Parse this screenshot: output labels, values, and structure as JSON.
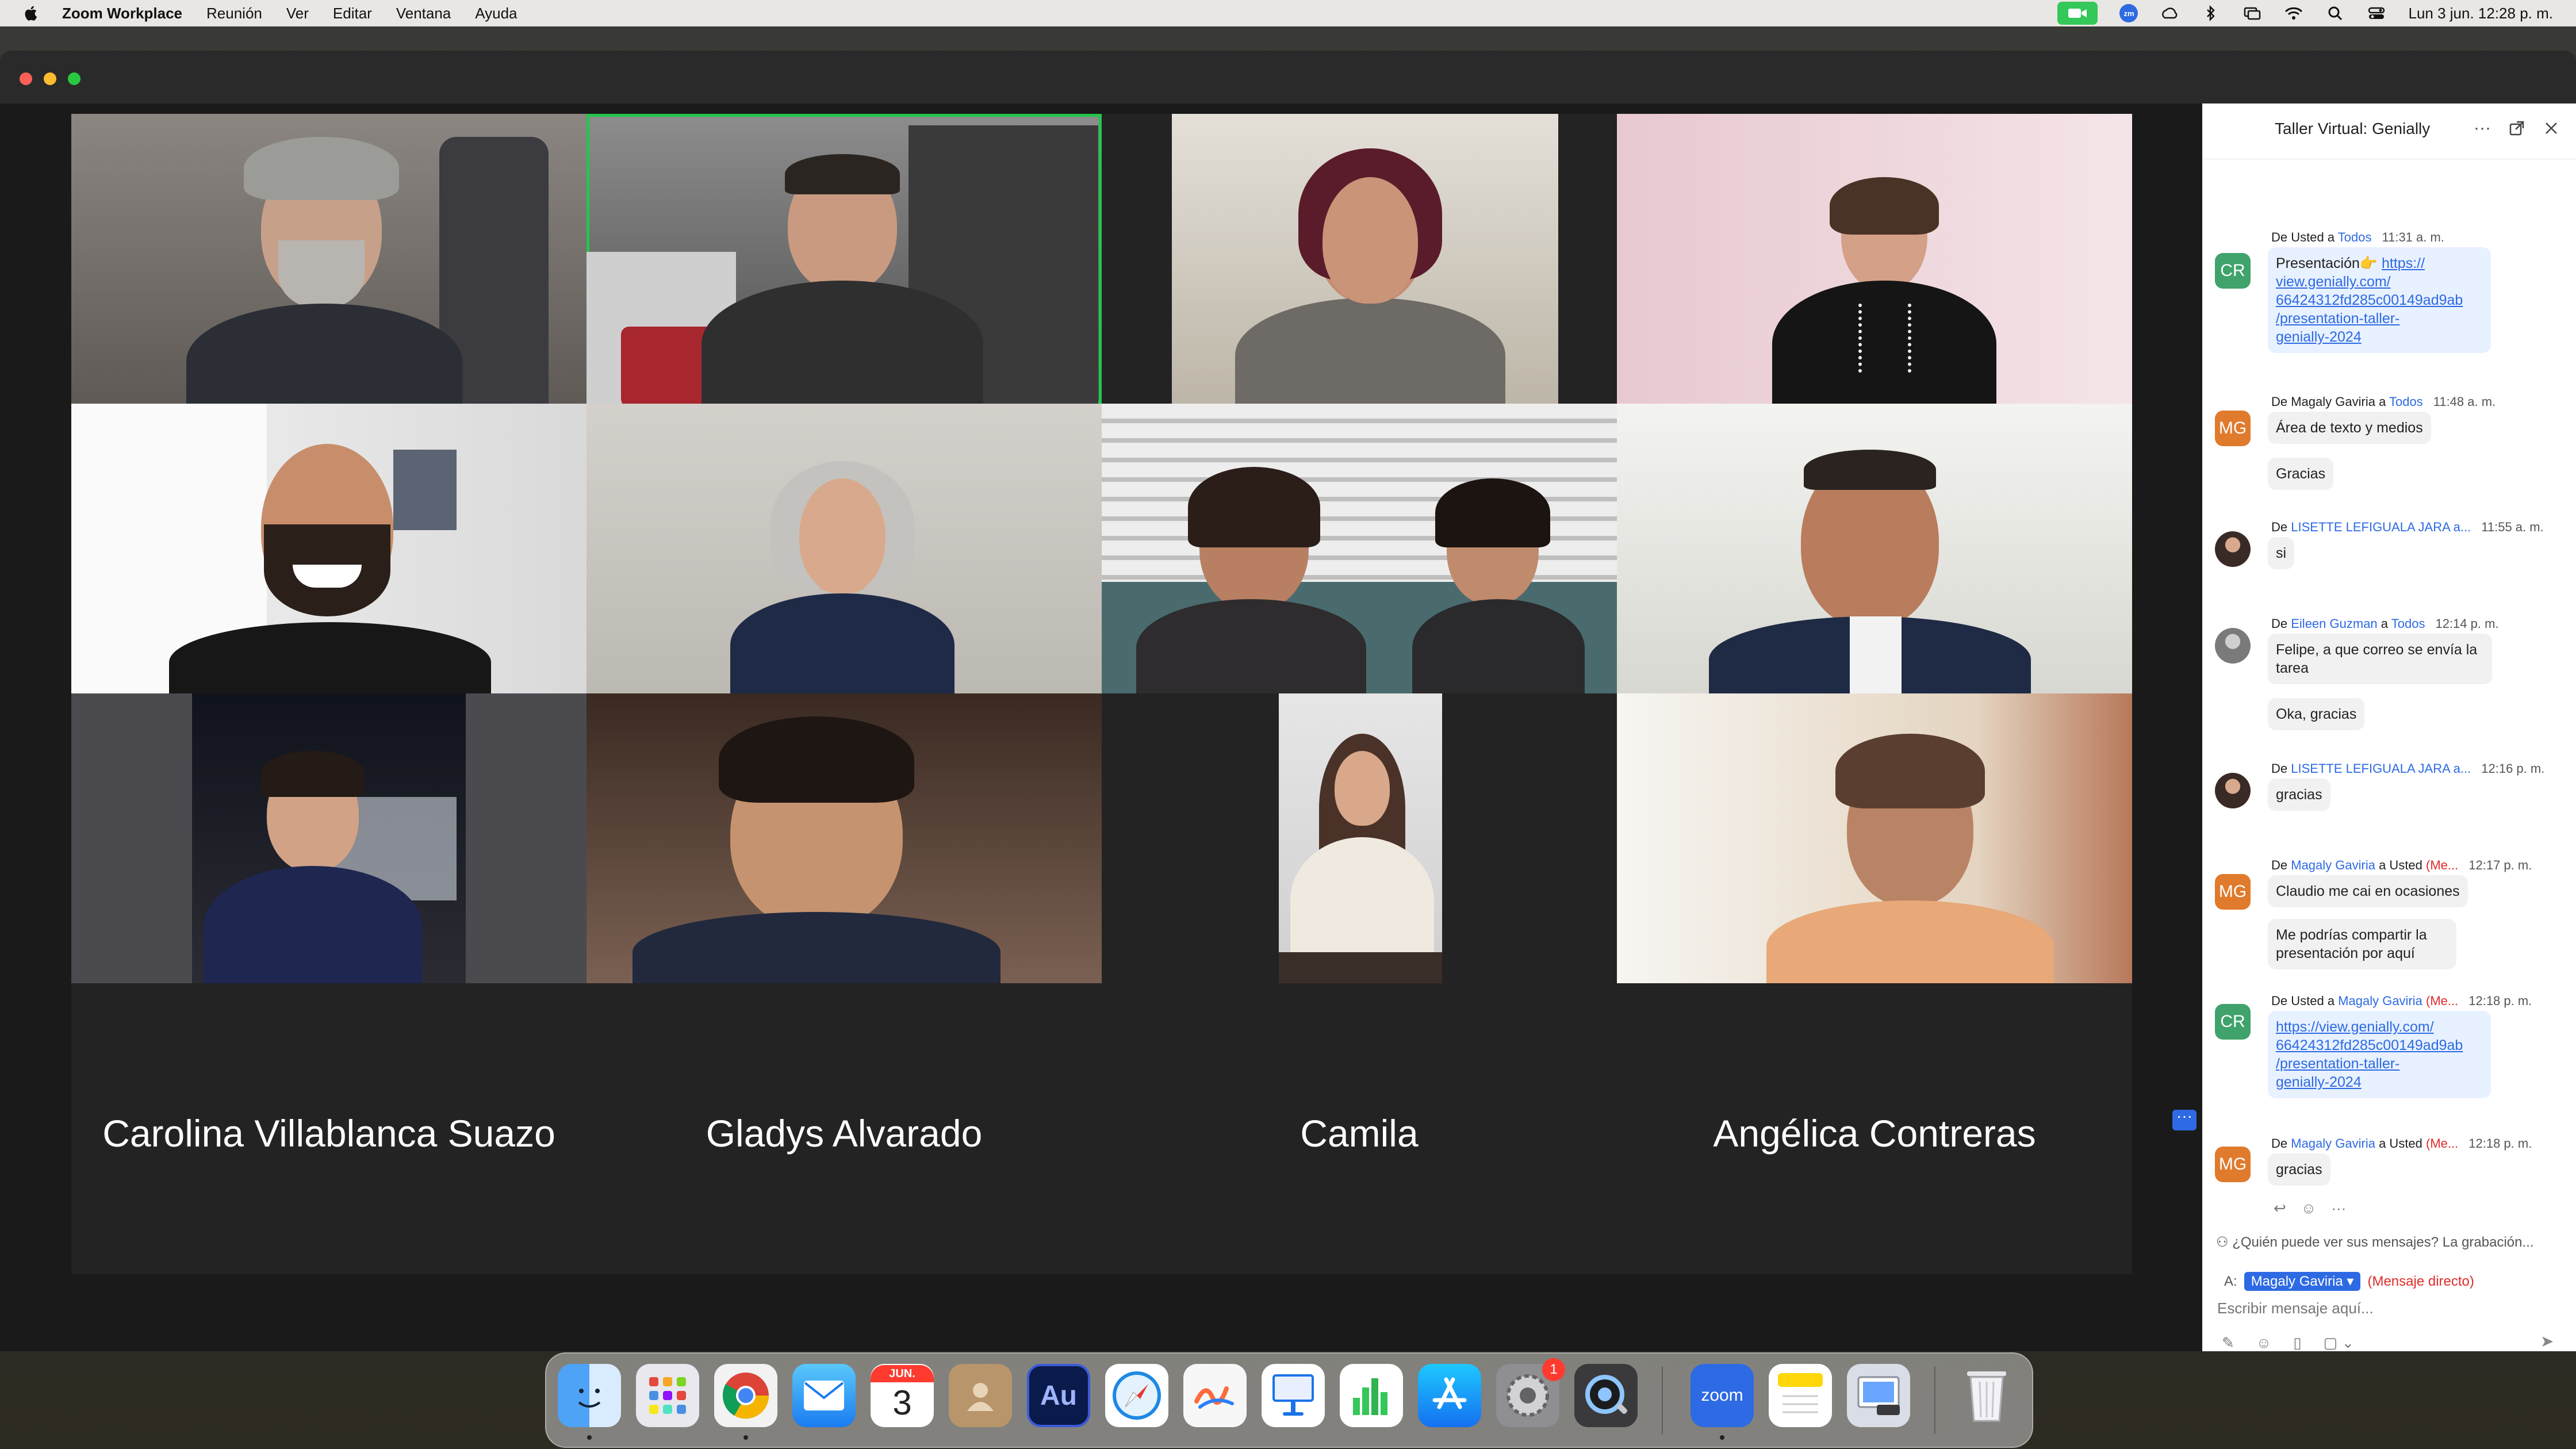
{
  "menubar": {
    "app_name": "Zoom Workplace",
    "menus": [
      "Reunión",
      "Ver",
      "Editar",
      "Ventana",
      "Ayuda"
    ],
    "clock": "Lun 3 jun.  12:28 p. m.",
    "zoom_badge": "zm"
  },
  "gallery": {
    "name_tiles": [
      "Carolina Villablanca Suazo",
      "Gladys Alvarado",
      "Camila",
      "Angélica Contreras"
    ],
    "more_label": "···"
  },
  "chat": {
    "title": "Taller Virtual: Genially",
    "messages": [
      {
        "avatar": "CR",
        "from": "De Usted a ",
        "to": "Todos",
        "time": "11:31 a. m.",
        "texts": [
          "Presentación👉 https://view.genially.com/66424312fd285c00149ad9ab/presentation-taller-genially-2024"
        ]
      },
      {
        "avatar": "MG",
        "from": "De Magaly Gaviria a ",
        "to": "Todos",
        "time": "11:48 a. m.",
        "texts": [
          "Área de texto y medios",
          "Gracias"
        ]
      },
      {
        "avatar": "",
        "from": "De ",
        "to": "LISETTE LEFIGUALA JARA a...",
        "time": "11:55 a. m.",
        "texts": [
          "si"
        ]
      },
      {
        "avatar": "",
        "from": "De ",
        "to": "Eileen Guzman",
        "to2": "Todos",
        "time": "12:14 p. m.",
        "texts": [
          "Felipe, a que correo se envía la tarea",
          "Oka, gracias"
        ]
      },
      {
        "avatar": "",
        "from": "De ",
        "to": "LISETTE LEFIGUALA JARA a...",
        "time": "12:16 p. m.",
        "texts": [
          "gracias"
        ]
      },
      {
        "avatar": "MG",
        "from": "De ",
        "to": "Magaly Gaviria",
        "mid": " a Usted ",
        "dm": "(Me...",
        "time": "12:17 p. m.",
        "texts": [
          "Claudio me cai en ocasiones",
          "Me podrías compartir la presentación por aquí"
        ]
      },
      {
        "avatar": "CR",
        "from": "De Usted a ",
        "to": "Magaly Gaviria",
        "dm": " (Me...",
        "time": "12:18 p. m.",
        "texts": [
          "https://view.genially.com/66424312fd285c00149ad9ab/presentation-taller-genially-2024"
        ]
      },
      {
        "avatar": "MG",
        "from": "De ",
        "to": "Magaly Gaviria",
        "mid": " a Usted ",
        "dm": "(Me...",
        "time": "12:18 p. m.",
        "texts": [
          "gracias"
        ]
      }
    ],
    "link_parts": {
      "presentacion_prefix": "Presentación👉 ",
      "first_link_lines": [
        "https://",
        "view.genially.com/",
        "66424312fd285c00149ad9ab",
        "/presentation-taller-",
        "genially-2024"
      ],
      "second_link_lines": [
        "https://view.genially.com/",
        "66424312fd285c00149ad9ab",
        "/presentation-taller-",
        "genially-2024"
      ]
    },
    "privacy_notice": "¿Quién puede ver sus mensajes? La grabación...",
    "recipient_label": "A:",
    "recipient": "Magaly Gaviria ▾",
    "recipient_mode": "(Mensaje directo)",
    "input_placeholder": "Escribir mensaje aquí..."
  },
  "dock": {
    "calendar_month": "JUN.",
    "calendar_day": "3",
    "audition_label": "Au",
    "zoom_label": "zoom",
    "settings_badge": "1"
  },
  "colors": {
    "accent": "#2d6ae3",
    "active_speaker": "#22c74a",
    "direct_message": "#e02b2b"
  }
}
